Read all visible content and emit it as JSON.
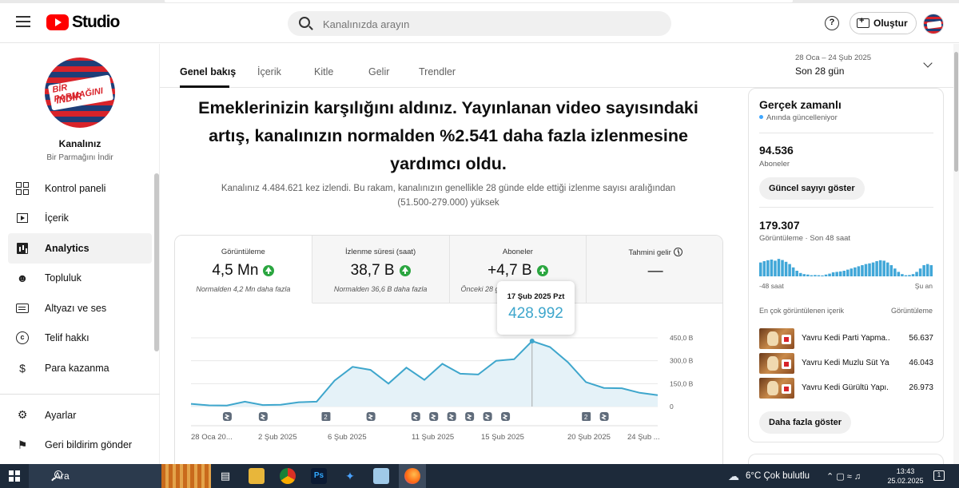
{
  "app": {
    "logo_text": "Studio"
  },
  "search": {
    "placeholder": "Kanalınızda arayın"
  },
  "header": {
    "help_icon": "?",
    "create_label": "Oluştur"
  },
  "channel": {
    "title": "Kanalınız",
    "name": "Bir Parmağını İndir",
    "avatar_text_1": "BİR PARMAĞINI",
    "avatar_text_2": "İNDİR"
  },
  "sidebar": {
    "items": [
      {
        "label": "Kontrol paneli",
        "icon": "dashboard-icon"
      },
      {
        "label": "İçerik",
        "icon": "content-icon"
      },
      {
        "label": "Analytics",
        "icon": "analytics-icon"
      },
      {
        "label": "Topluluk",
        "icon": "community-icon"
      },
      {
        "label": "Altyazı ve ses",
        "icon": "subtitles-icon"
      },
      {
        "label": "Telif hakkı",
        "icon": "copyright-icon"
      },
      {
        "label": "Para kazanma",
        "icon": "dollar-icon"
      }
    ],
    "bottom_items": [
      {
        "label": "Ayarlar",
        "icon": "gear-icon"
      },
      {
        "label": "Geri bildirim gönder",
        "icon": "feedback-icon"
      }
    ]
  },
  "tabs": [
    "Genel bakış",
    "İçerik",
    "Kitle",
    "Gelir",
    "Trendler"
  ],
  "date_range": {
    "range": "28 Oca – 24 Şub 2025",
    "label": "Son 28 gün"
  },
  "main": {
    "headline": "Emeklerinizin karşılığını aldınız. Yayınlanan video sayısındaki artış, kanalınızın normalden %2.541 daha fazla izlenmesine yardımcı oldu.",
    "subline": "Kanalınız 4.484.621 kez izlendi. Bu rakam, kanalınızın genellikle 28 günde elde ettiği izlenme sayısı aralığından (51.500-279.000) yüksek"
  },
  "metrics": [
    {
      "label": "Görüntüleme",
      "value": "4,5 Mn",
      "note": "Normalden 4,2 Mn daha fazla"
    },
    {
      "label": "İzlenme süresi (saat)",
      "value": "38,7 B",
      "note": "Normalden 36,6 B daha fazla"
    },
    {
      "label": "Aboneler",
      "value": "+4,7 B",
      "note": "Önceki 28 g"
    },
    {
      "label": "Tahmini gelir",
      "value": "—",
      "note": ""
    }
  ],
  "tooltip": {
    "date": "17 Şub 2025 Pzt",
    "value": "428.992"
  },
  "chart_data": {
    "type": "area",
    "x_labels": [
      "28 Oca 20...",
      "2 Şub 2025",
      "6 Şub 2025",
      "11 Şub 2025",
      "15 Şub 2025",
      "20 Şub 2025",
      "24 Şub ..."
    ],
    "y_ticks": [
      "450,0 B",
      "300,0 B",
      "150,0 B",
      "0"
    ],
    "ylim": [
      0,
      450000
    ],
    "grid": true,
    "values": [
      18000,
      8000,
      7000,
      32000,
      10000,
      12000,
      28000,
      32000,
      170000,
      260000,
      240000,
      150000,
      255000,
      175000,
      280000,
      215000,
      210000,
      300000,
      310000,
      428992,
      390000,
      290000,
      160000,
      122000,
      120000,
      90000,
      75000
    ],
    "markers": [
      {
        "type": "icon",
        "index": 4
      },
      {
        "type": "icon",
        "index": 8
      },
      {
        "type": "label",
        "index": 15,
        "text": "2"
      },
      {
        "type": "icon",
        "index": 20
      },
      {
        "type": "icon",
        "index": 25
      },
      {
        "type": "icon",
        "index": 27
      },
      {
        "type": "icon",
        "index": 29
      },
      {
        "type": "icon",
        "index": 31
      },
      {
        "type": "icon",
        "index": 33
      },
      {
        "type": "icon",
        "index": 35
      },
      {
        "type": "label",
        "index": 44,
        "text": "2"
      },
      {
        "type": "icon",
        "index": 46
      }
    ],
    "accent": "#3ea6cc"
  },
  "realtime": {
    "title": "Gerçek zamanlı",
    "live": "Anında güncelleniyor",
    "subs_value": "94.536",
    "subs_label": "Aboneler",
    "subs_button": "Güncel sayıyı göster",
    "views_value": "179.307",
    "views_label": "Görüntüleme · Son 48 saat",
    "axis_left": "-48 saat",
    "axis_right": "Şu an",
    "bars": [
      0.62,
      0.68,
      0.72,
      0.75,
      0.7,
      0.78,
      0.73,
      0.65,
      0.55,
      0.4,
      0.25,
      0.15,
      0.1,
      0.08,
      0.05,
      0.06,
      0.05,
      0.04,
      0.08,
      0.12,
      0.18,
      0.2,
      0.22,
      0.25,
      0.3,
      0.35,
      0.4,
      0.45,
      0.5,
      0.55,
      0.58,
      0.62,
      0.68,
      0.72,
      0.7,
      0.62,
      0.5,
      0.35,
      0.2,
      0.1,
      0.05,
      0.06,
      0.1,
      0.2,
      0.35,
      0.5,
      0.55,
      0.5
    ],
    "top_header_left": "En çok görüntülenen içerik",
    "top_header_right": "Görüntüleme",
    "top": [
      {
        "title": "Yavru Kedi Parti Yapma...",
        "views": "56.637"
      },
      {
        "title": "Yavru Kedi Muzlu Süt Ya...",
        "views": "46.043"
      },
      {
        "title": "Yavru Kedi Gürültü Yapı...",
        "views": "26.973"
      }
    ],
    "more_button": "Daha fazla göster"
  },
  "taskbar": {
    "search_label": "Ara",
    "weather": "6°C  Çok bulutlu",
    "time": "13:43",
    "date": "25.02.2025",
    "notifications": "1"
  }
}
